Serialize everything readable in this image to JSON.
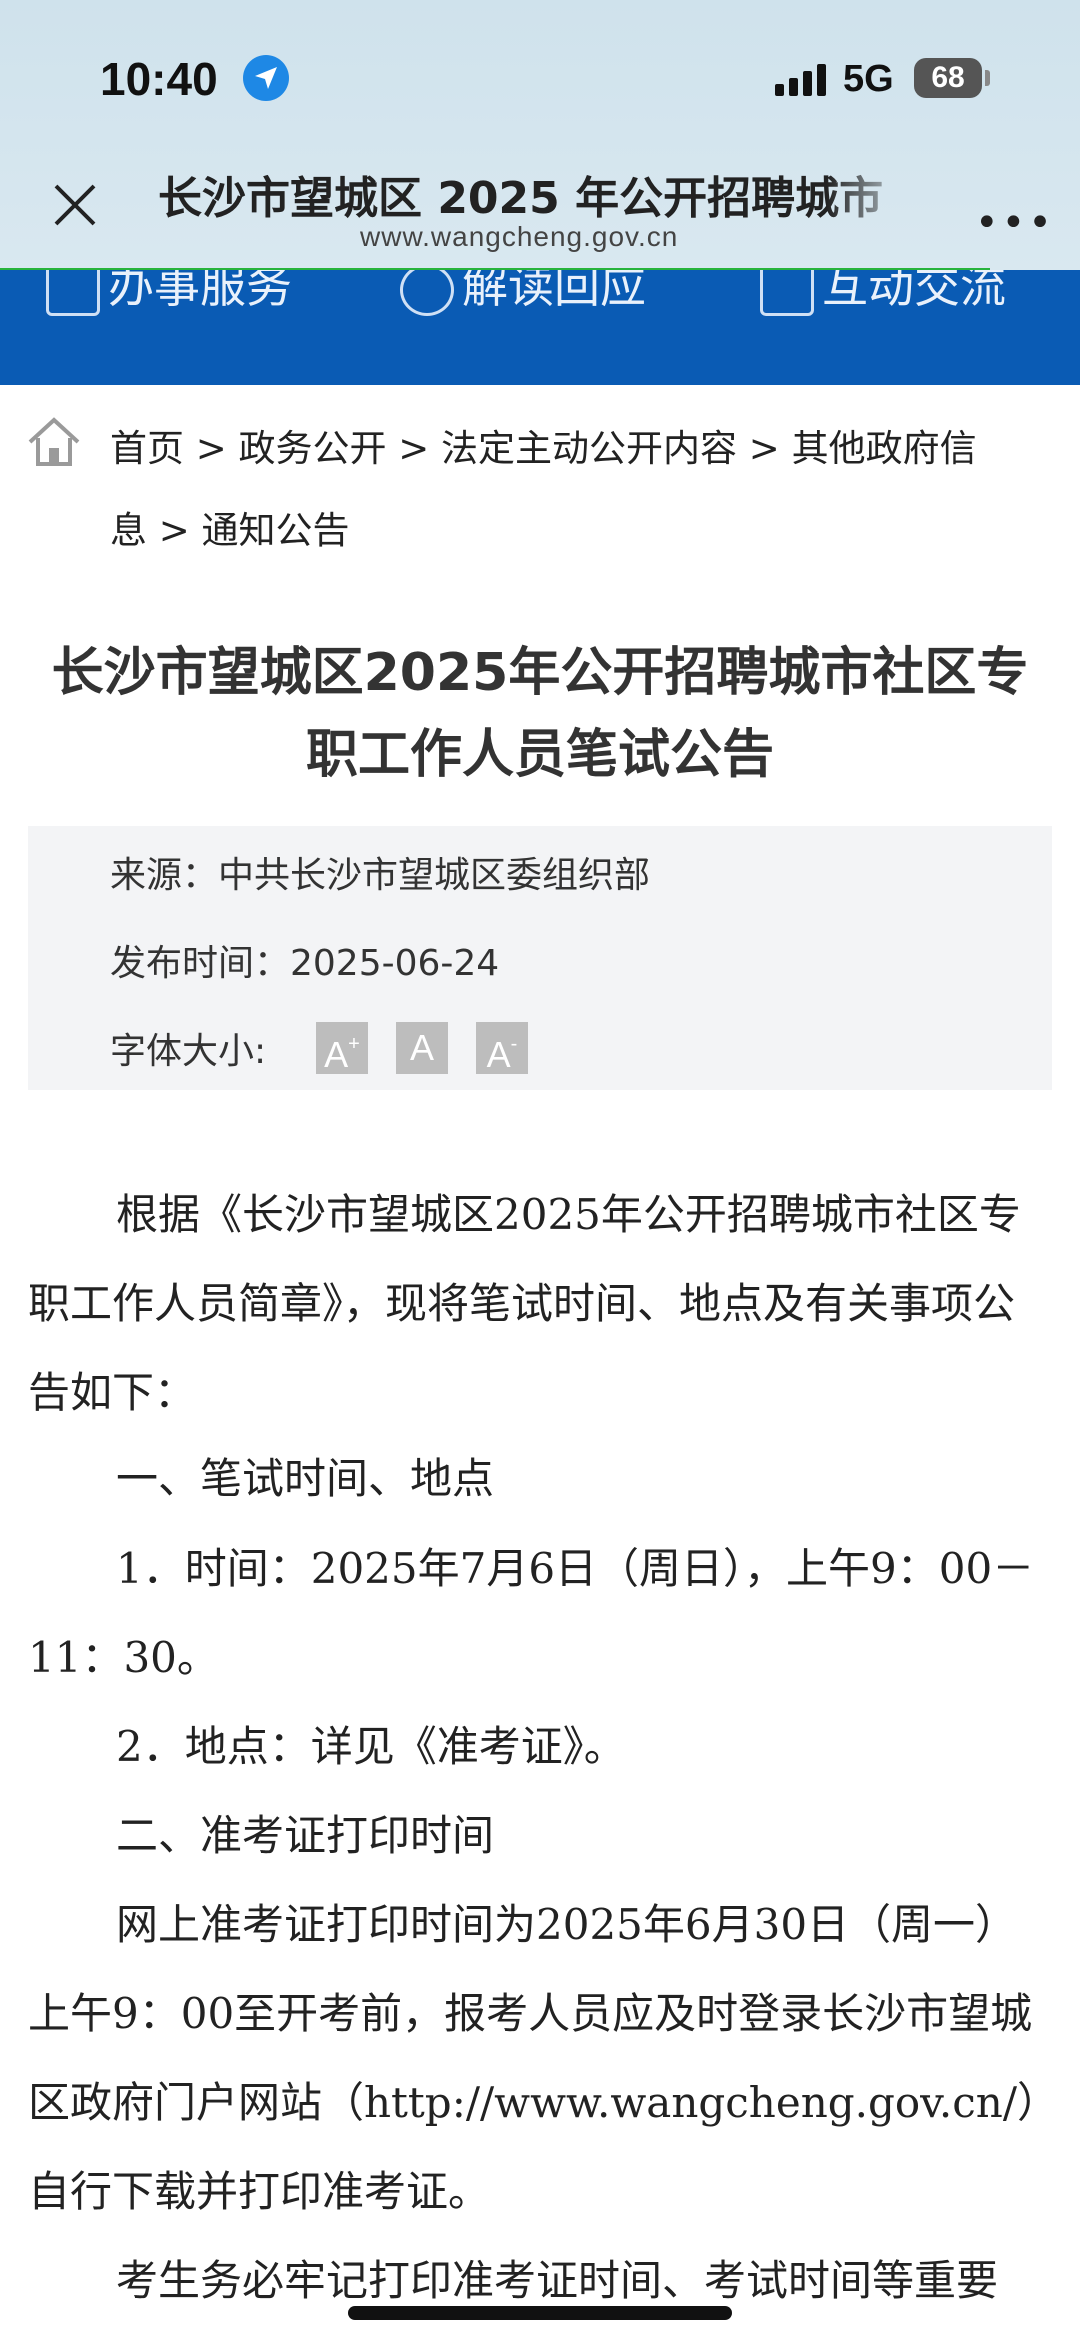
{
  "status_bar": {
    "time": "10:40",
    "network": "5G",
    "battery": "68"
  },
  "browser": {
    "title": "长沙市望城区 2025 年公开招聘城市",
    "url": "www.wangcheng.gov.cn"
  },
  "nav": {
    "items": [
      "办事服务",
      "解读回应",
      "互动交流"
    ]
  },
  "breadcrumb": {
    "text": "首页 > 政务公开 > 法定主动公开内容 > 其他政府信息 > 通知公告"
  },
  "article": {
    "title": "长沙市望城区2025年公开招聘城市社区专职工作人员笔试公告",
    "meta": {
      "source": "来源：中共长沙市望城区委组织部",
      "date": "发布时间：2025-06-24",
      "font_size_label": "字体大小:",
      "font_buttons": [
        "A",
        "A",
        "A"
      ]
    },
    "paragraphs": [
      "根据《长沙市望城区2025年公开招聘城市社区专职工作人员简章》，现将笔试时间、地点及有关事项公告如下：",
      "一、笔试时间、地点",
      "1．时间：2025年7月6日（周日），上午9：00－11：30。",
      "2．地点：详见《准考证》。",
      "二、准考证打印时间",
      "网上准考证打印时间为2025年6月30日（周一）上午9：00至开考前，报考人员应及时登录长沙市望城区政府门户网站（http://www.wangcheng.gov.cn/）自行下载并打印准考证。",
      "考生务必牢记打印准考证时间、考试时间等重要"
    ]
  }
}
